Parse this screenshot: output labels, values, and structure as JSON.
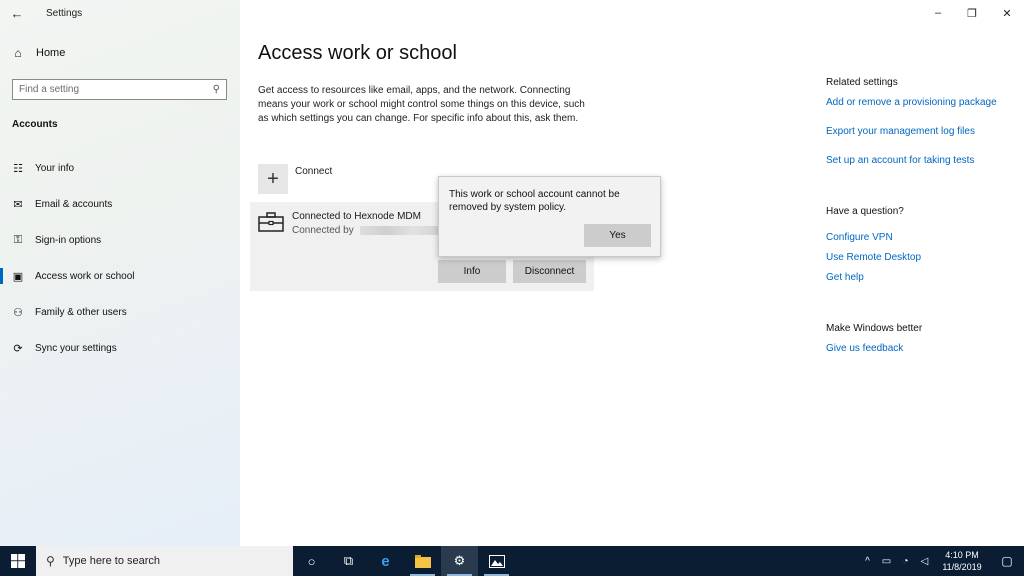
{
  "window": {
    "title": "Settings",
    "minimize": "–",
    "restore": "❐",
    "close": "✕"
  },
  "sidebar": {
    "home": "Home",
    "search_placeholder": "Find a setting",
    "section": "Accounts",
    "items": [
      {
        "label": "Your info",
        "icon": "person-card-icon"
      },
      {
        "label": "Email & accounts",
        "icon": "mail-icon"
      },
      {
        "label": "Sign-in options",
        "icon": "key-icon"
      },
      {
        "label": "Access work or school",
        "icon": "briefcase-icon"
      },
      {
        "label": "Family & other users",
        "icon": "people-icon"
      },
      {
        "label": "Sync your settings",
        "icon": "sync-icon"
      }
    ]
  },
  "main": {
    "title": "Access work or school",
    "description": "Get access to resources like email, apps, and the network. Connecting means your work or school might control some things on this device, such as which settings you can change. For specific info about this, ask them.",
    "connect_label": "Connect",
    "account": {
      "title": "Connected to Hexnode MDM",
      "subtitle": "Connected by",
      "info_button": "Info",
      "disconnect_button": "Disconnect"
    },
    "flyout": {
      "message": "This work or school account cannot be removed by system policy.",
      "yes_button": "Yes"
    }
  },
  "related": {
    "heading": "Related settings",
    "links": [
      "Add or remove a provisioning package",
      "Export your management log files",
      "Set up an account for taking tests"
    ],
    "question_heading": "Have a question?",
    "question_links": [
      "Configure VPN",
      "Use Remote Desktop",
      "Get help"
    ],
    "better_heading": "Make Windows better",
    "feedback_link": "Give us feedback"
  },
  "taskbar": {
    "search_placeholder": "Type here to search",
    "time": "4:10 PM",
    "date": "11/8/2019"
  }
}
